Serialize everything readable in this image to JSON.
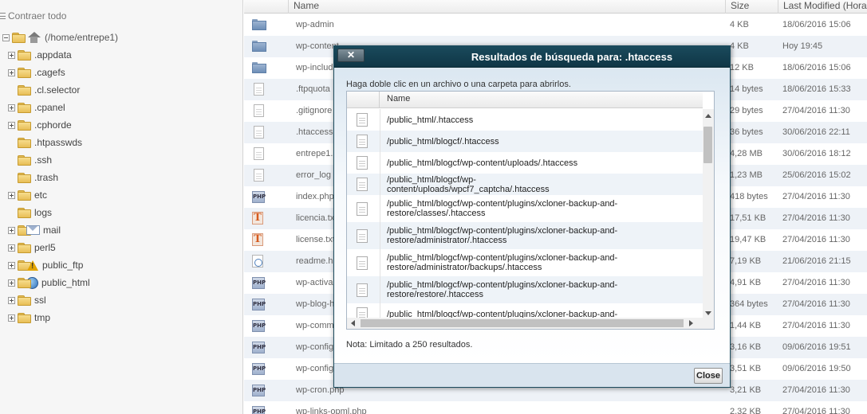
{
  "sidebar": {
    "collapse_all_label": "Contraer todo",
    "root_label": "(/home/entrepe1)",
    "items": [
      {
        "label": ".appdata",
        "expandable": true
      },
      {
        "label": ".cagefs",
        "expandable": true
      },
      {
        "label": ".cl.selector",
        "expandable": false
      },
      {
        "label": ".cpanel",
        "expandable": true
      },
      {
        "label": ".cphorde",
        "expandable": true
      },
      {
        "label": ".htpasswds",
        "expandable": false
      },
      {
        "label": ".ssh",
        "expandable": false
      },
      {
        "label": ".trash",
        "expandable": false
      },
      {
        "label": "etc",
        "expandable": true
      },
      {
        "label": "logs",
        "expandable": false
      },
      {
        "label": "mail",
        "expandable": true,
        "icon": "mail-icon"
      },
      {
        "label": "perl5",
        "expandable": true
      },
      {
        "label": "public_ftp",
        "expandable": true,
        "icon": "ftp-warning-icon"
      },
      {
        "label": "public_html",
        "expandable": true,
        "icon": "globe-icon"
      },
      {
        "label": "ssl",
        "expandable": true
      },
      {
        "label": "tmp",
        "expandable": true
      }
    ]
  },
  "file_list": {
    "columns": {
      "name": "Name",
      "size": "Size",
      "modified": "Last Modified (Hora de"
    },
    "rows": [
      {
        "icon": "folder-icon",
        "name": "wp-admin",
        "size": "4 KB",
        "modified": "18/06/2016 15:06"
      },
      {
        "icon": "folder-icon",
        "name": "wp-content",
        "size": "4 KB",
        "modified": "Hoy 19:45"
      },
      {
        "icon": "folder-icon",
        "name": "wp-includes",
        "size": "12 KB",
        "modified": "18/06/2016 15:06"
      },
      {
        "icon": "file-icon",
        "name": ".ftpquota",
        "size": "14 bytes",
        "modified": "18/06/2016 15:33"
      },
      {
        "icon": "file-icon",
        "name": ".gitignore",
        "size": "29 bytes",
        "modified": "27/04/2016 11:30"
      },
      {
        "icon": "file-icon",
        "name": ".htaccess",
        "size": "36 bytes",
        "modified": "30/06/2016 22:11"
      },
      {
        "icon": "file-icon",
        "name": "entrepe1.",
        "size": "4,28 MB",
        "modified": "30/06/2016 18:12"
      },
      {
        "icon": "file-icon",
        "name": "error_log",
        "size": "1,23 MB",
        "modified": "25/06/2016 15:02"
      },
      {
        "icon": "php-icon",
        "name": "index.php",
        "size": "418 bytes",
        "modified": "27/04/2016 11:30"
      },
      {
        "icon": "text-icon",
        "name": "licencia.tx",
        "size": "17,51 KB",
        "modified": "27/04/2016 11:30"
      },
      {
        "icon": "text-icon",
        "name": "license.txt",
        "size": "19,47 KB",
        "modified": "27/04/2016 11:30"
      },
      {
        "icon": "html-icon",
        "name": "readme.h",
        "size": "7,19 KB",
        "modified": "21/06/2016 21:15"
      },
      {
        "icon": "php-icon",
        "name": "wp-activa",
        "size": "4,91 KB",
        "modified": "27/04/2016 11:30"
      },
      {
        "icon": "php-icon",
        "name": "wp-blog-h",
        "size": "364 bytes",
        "modified": "27/04/2016 11:30"
      },
      {
        "icon": "php-icon",
        "name": "wp-comm",
        "size": "1,44 KB",
        "modified": "27/04/2016 11:30"
      },
      {
        "icon": "php-icon",
        "name": "wp-config",
        "size": "3,16 KB",
        "modified": "09/06/2016 19:51"
      },
      {
        "icon": "php-icon",
        "name": "wp-config",
        "size": "3,51 KB",
        "modified": "09/06/2016 19:50"
      },
      {
        "icon": "php-icon",
        "name": "wp-cron.php",
        "size": "3,21 KB",
        "modified": "27/04/2016 11:30"
      },
      {
        "icon": "php-icon",
        "name": "wp-links-opml.php",
        "size": "2,32 KB",
        "modified": "27/04/2016 11:30"
      }
    ]
  },
  "modal": {
    "title": "Resultados de búsqueda para: .htaccess",
    "close_x_label": "✕",
    "instruction": "Haga doble clic en un archivo o una carpeta para abrirlos.",
    "column_name": "Name",
    "results": [
      {
        "line1": "/public_html/.htaccess",
        "line2": ""
      },
      {
        "line1": "/public_html/blogcf/.htaccess",
        "line2": ""
      },
      {
        "line1": "/public_html/blogcf/wp-content/uploads/.htaccess",
        "line2": ""
      },
      {
        "line1": "/public_html/blogcf/wp-content/uploads/wpcf7_captcha/.htaccess",
        "line2": ""
      },
      {
        "line1": "/public_html/blogcf/wp-content/plugins/xcloner-backup-and-",
        "line2": "restore/classes/.htaccess"
      },
      {
        "line1": "/public_html/blogcf/wp-content/plugins/xcloner-backup-and-",
        "line2": "restore/administrator/.htaccess"
      },
      {
        "line1": "/public_html/blogcf/wp-content/plugins/xcloner-backup-and-",
        "line2": "restore/administrator/backups/.htaccess"
      },
      {
        "line1": "/public_html/blogcf/wp-content/plugins/xcloner-backup-and-",
        "line2": "restore/restore/.htaccess"
      },
      {
        "line1": "/public_html/blogcf/wp-content/plugins/xcloner-backup-and-",
        "line2": ""
      }
    ],
    "note": "Nota: Limitado a 250 resultados.",
    "close_button_label": "Close"
  }
}
